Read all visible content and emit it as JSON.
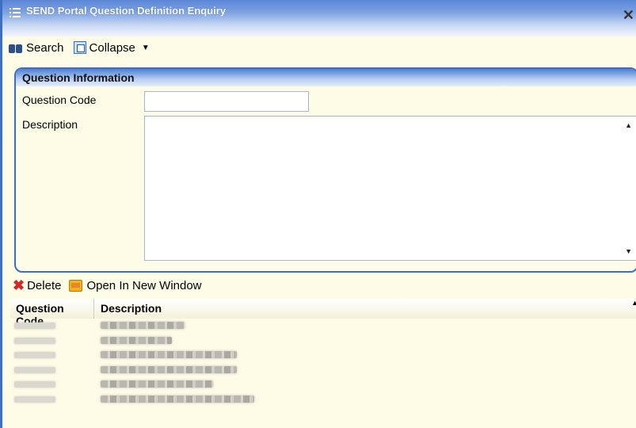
{
  "window": {
    "title": "SEND Portal Question Definition Enquiry",
    "close_glyph": "✕"
  },
  "toolbar": {
    "search_label": "Search",
    "search_icon": "binoculars-icon",
    "collapse_label": "Collapse",
    "collapse_icon": "collapse-icon",
    "dropdown_glyph": "▼"
  },
  "panel": {
    "header": "Question Information",
    "question_code_label": "Question Code",
    "question_code_value": "",
    "description_label": "Description",
    "description_value": ""
  },
  "actions": {
    "delete_label": "Delete",
    "open_new_window_label": "Open In New Window"
  },
  "grid": {
    "columns": [
      "Question Code",
      "Description"
    ]
  },
  "colors": {
    "title_bar": "#5b86d6",
    "panel_border": "#3b6ec6",
    "background": "#fdfce6",
    "delete_icon": "#d62626",
    "folder_icon": "#f3b21c"
  }
}
